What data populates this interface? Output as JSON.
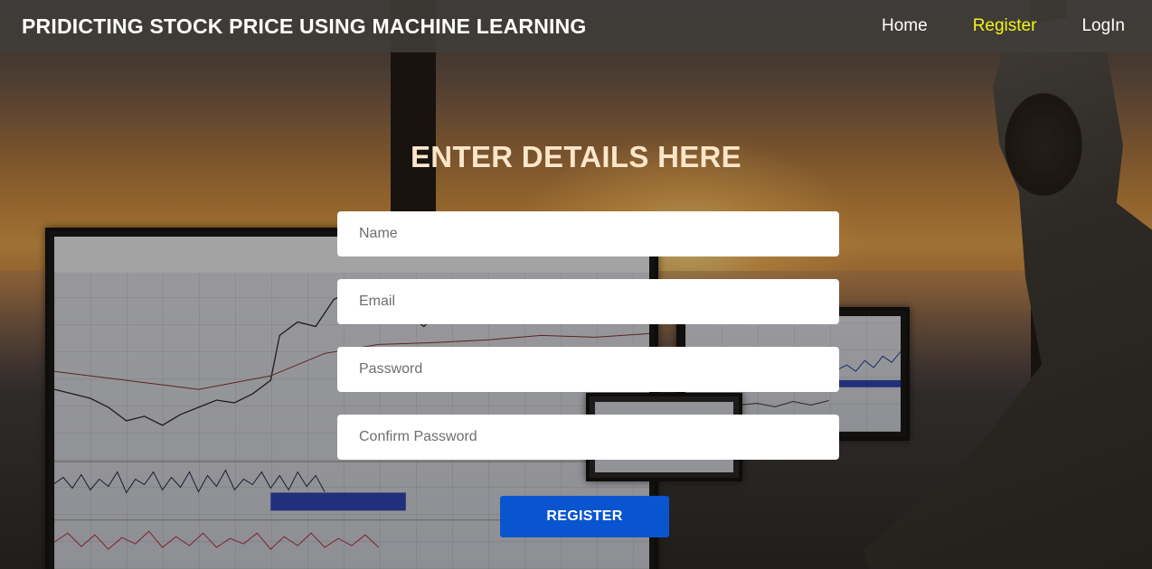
{
  "navbar": {
    "brand": "PRIDICTING STOCK PRICE USING MACHINE LEARNING",
    "links": [
      {
        "label": "Home",
        "active": false
      },
      {
        "label": "Register",
        "active": true
      },
      {
        "label": "LogIn",
        "active": false
      }
    ],
    "active_color": "#f4f41a"
  },
  "form": {
    "heading": "ENTER DETAILS HERE",
    "name_placeholder": "Name",
    "email_placeholder": "Email",
    "password_placeholder": "Password",
    "confirm_password_placeholder": "Confirm Password",
    "submit_label": "REGISTER",
    "submit_color": "#0a55cf"
  },
  "background": {
    "theme": "trading desk at sunset",
    "accent_heading_color": "#fbe6c9"
  }
}
